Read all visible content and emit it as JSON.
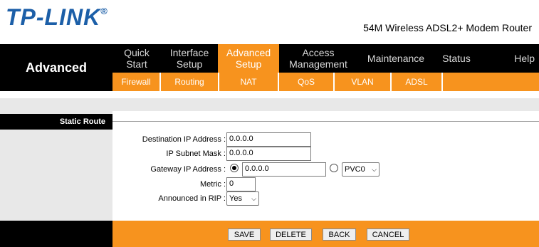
{
  "brand": {
    "logo": "TP-LINK",
    "trademark": "®",
    "product": "54M Wireless ADSL2+ Modem Router"
  },
  "nav": {
    "section": "Advanced",
    "tabs": [
      {
        "label": "Quick Start"
      },
      {
        "label": "Interface Setup"
      },
      {
        "label": "Advanced Setup"
      },
      {
        "label": "Access Management"
      },
      {
        "label": "Maintenance"
      },
      {
        "label": "Status"
      },
      {
        "label": "Help"
      }
    ],
    "subtabs": [
      "Firewall",
      "Routing",
      "NAT",
      "QoS",
      "VLAN",
      "ADSL"
    ]
  },
  "page": {
    "section_title": "Static Route",
    "form": {
      "dest_label": "Destination IP Address :",
      "dest_value": "0.0.0.0",
      "mask_label": "IP Subnet Mask :",
      "mask_value": "0.0.0.0",
      "gateway_label": "Gateway IP Address :",
      "gateway_value": "0.0.0.0",
      "pvc_value": "PVC0",
      "metric_label": "Metric :",
      "metric_value": "0",
      "rip_label": "Announced in RIP :",
      "rip_value": "Yes"
    }
  },
  "buttons": {
    "save": "SAVE",
    "delete": "DELETE",
    "back": "BACK",
    "cancel": "CANCEL"
  },
  "colors": {
    "accent": "#f7931e",
    "brand_blue": "#1c5fa8",
    "nav_bg": "#000000",
    "panel_grey": "#e8e8e8"
  }
}
